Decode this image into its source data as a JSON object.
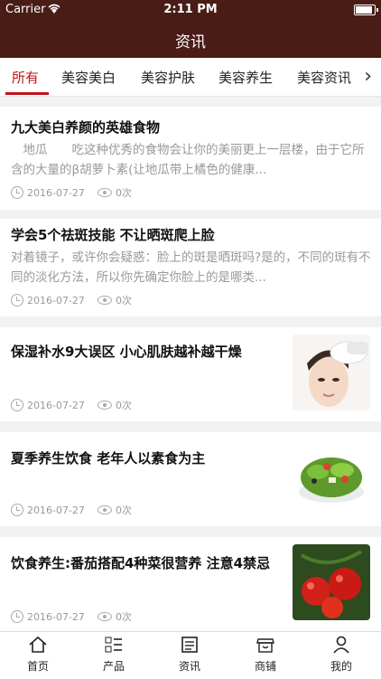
{
  "status": {
    "carrier": "Carrier",
    "time": "2:11 PM"
  },
  "nav": {
    "title": "资讯"
  },
  "tabs": [
    {
      "label": "所有",
      "active": true
    },
    {
      "label": "美容美白",
      "active": false
    },
    {
      "label": "美容护肤",
      "active": false
    },
    {
      "label": "美容养生",
      "active": false
    },
    {
      "label": "美容资讯",
      "active": false
    }
  ],
  "articles": [
    {
      "title": "九大美白养颜的英雄食物",
      "summary": "　地瓜　　吃这种优秀的食物会让你的美丽更上一层楼，由于它所含的大量的β胡萝卜素(让地瓜带上橘色的健康...",
      "date": "2016-07-27",
      "views": "0次"
    },
    {
      "title": "学会5个祛斑技能 不让晒斑爬上脸",
      "summary": "对着镜子，或许你会疑惑：脸上的斑是晒斑吗?是的，不同的斑有不同的淡化方法，所以你先确定你脸上的是哪类...",
      "date": "2016-07-27",
      "views": "0次"
    },
    {
      "title": "保湿补水9大误区 小心肌肤越补越干燥",
      "date": "2016-07-27",
      "views": "0次",
      "thumb": "face-mask-photo"
    },
    {
      "title": "夏季养生饮食 老年人以素食为主",
      "date": "2016-07-27",
      "views": "0次",
      "thumb": "salad-photo"
    },
    {
      "title": "饮食养生:番茄搭配4种菜很营养 注意4禁忌",
      "date": "2016-07-27",
      "views": "0次",
      "thumb": "tomato-photo"
    }
  ],
  "bottom_nav": [
    {
      "label": "首页",
      "icon": "home-icon"
    },
    {
      "label": "产品",
      "icon": "list-icon"
    },
    {
      "label": "资讯",
      "icon": "news-icon"
    },
    {
      "label": "商铺",
      "icon": "shop-icon"
    },
    {
      "label": "我的",
      "icon": "user-icon"
    }
  ]
}
